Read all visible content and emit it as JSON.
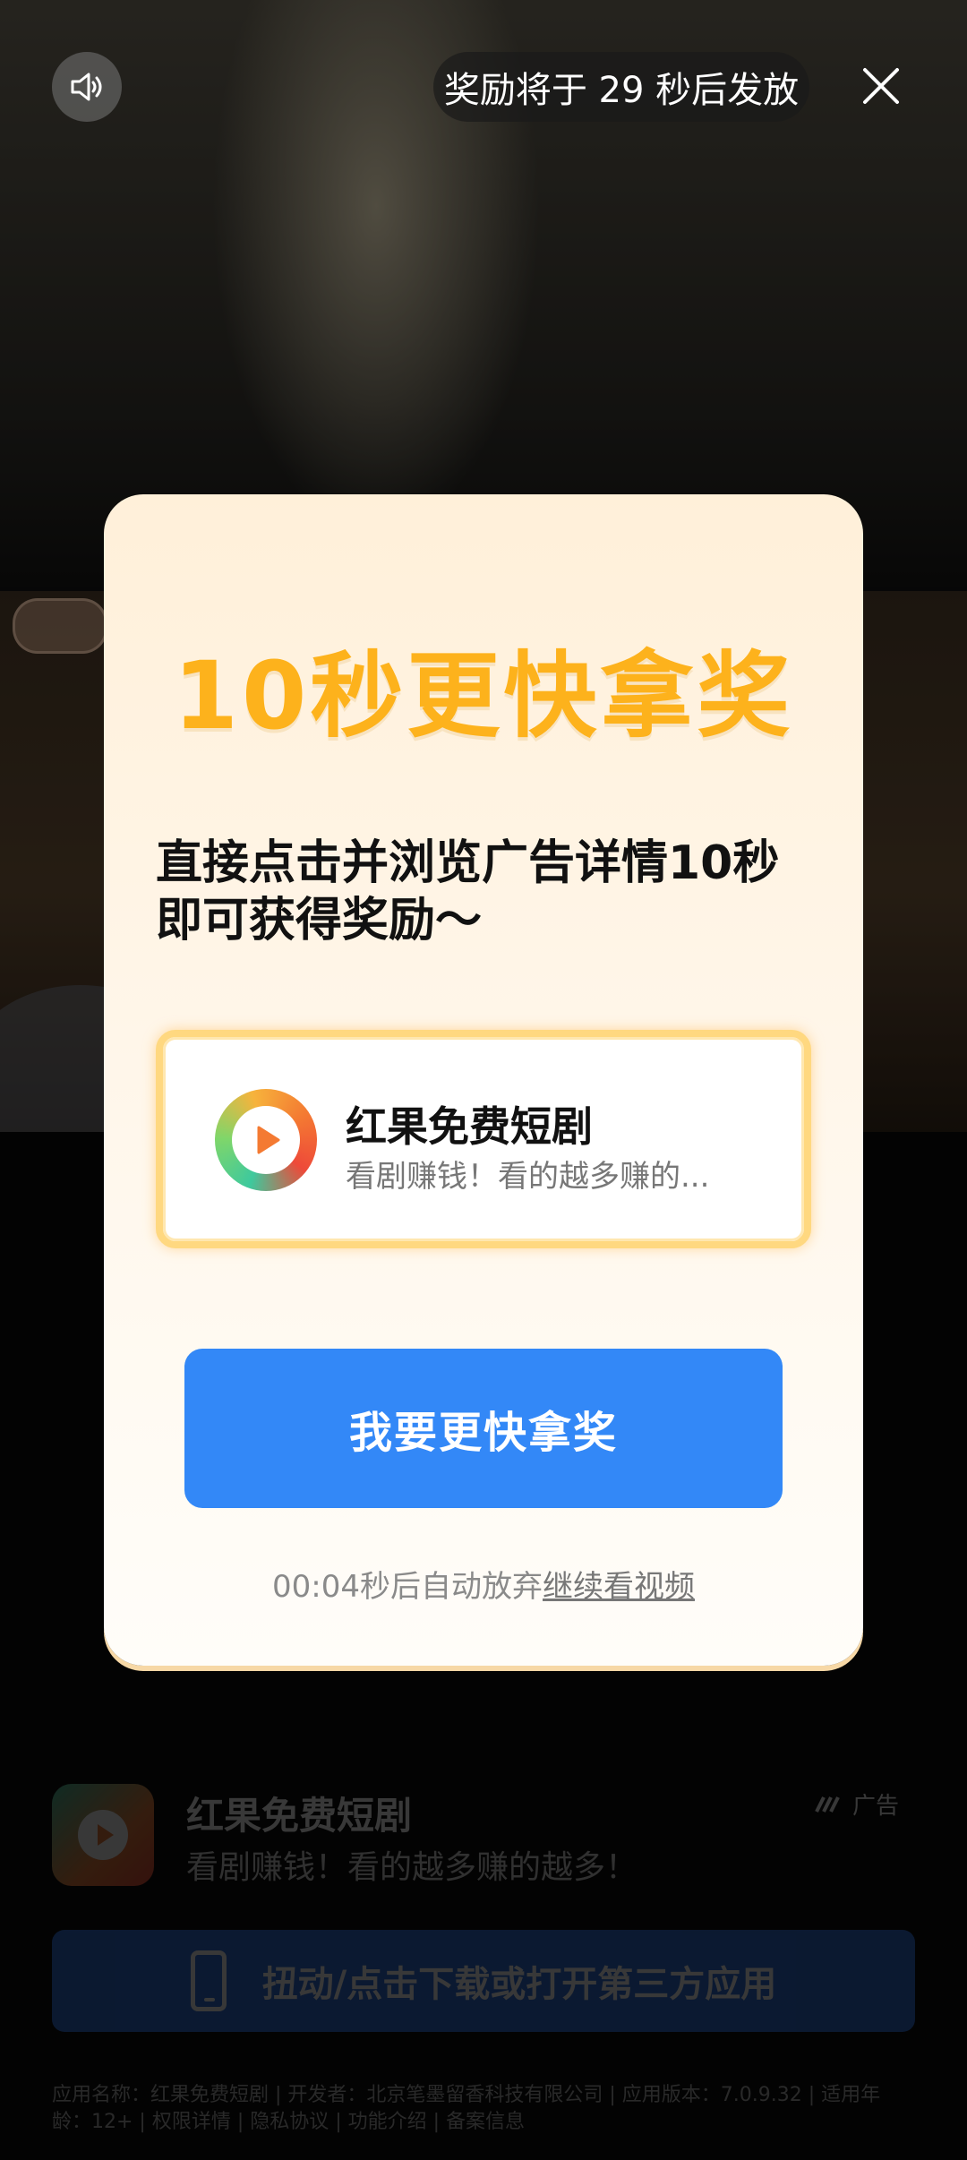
{
  "top_bar": {
    "reward_notice": "奖励将于 29 秒后发放",
    "sound_icon": "speaker-icon",
    "close_icon": "close-icon"
  },
  "modal": {
    "title": "10秒更快拿奖",
    "subtitle": "直接点击并浏览广告详情10秒即可获得奖励～",
    "app_card": {
      "name": "红果免费短剧",
      "description": "看剧赚钱！看的越多赚的..."
    },
    "primary_button": "我要更快拿奖",
    "countdown_text": "00:04秒后自动放弃",
    "continue_link": "继续看视频"
  },
  "bottom_ad": {
    "app_name": "红果免费短剧",
    "app_desc": "看剧赚钱！看的越多赚的越多！",
    "ad_tag": "广告",
    "cta": "扭动/点击下载或打开第三方应用",
    "info": "应用名称：红果免费短剧 | 开发者：北京笔墨留香科技有限公司 | 应用版本：7.0.9.32 | 适用年龄：12+ | 权限详情 | 隐私协议 | 功能介绍 | 备案信息"
  },
  "colors": {
    "title_accent": "#fdb21c",
    "primary_button": "#3388f7",
    "modal_bg": "#fff5e7"
  }
}
